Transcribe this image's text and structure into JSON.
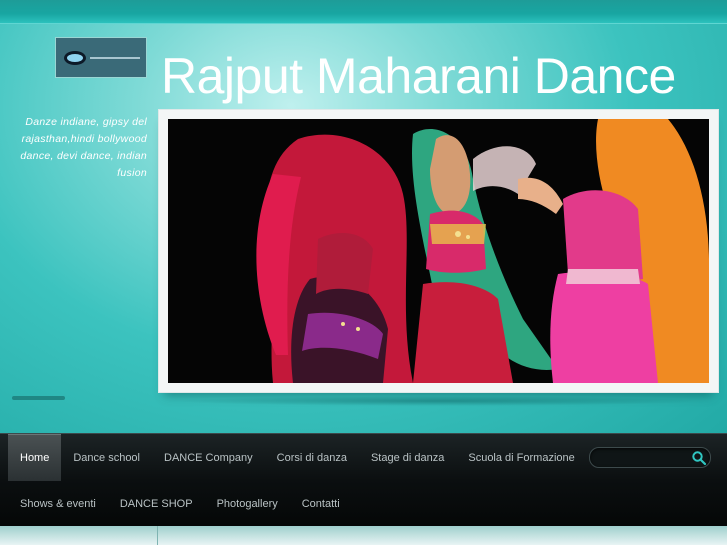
{
  "site": {
    "title": "Rajput Maharani Dance",
    "tagline": "Danze indiane, gipsy del rajasthan,hindi bollywood dance, devi dance, indian fusion"
  },
  "logo": {
    "icon": "eye-logo-icon"
  },
  "hero": {
    "image": "dancers-photo"
  },
  "nav": {
    "row1": [
      {
        "label": "Home",
        "active": true
      },
      {
        "label": "Dance school"
      },
      {
        "label": "DANCE Company"
      },
      {
        "label": "Corsi di danza"
      },
      {
        "label": "Stage di danza"
      },
      {
        "label": "Scuola di Formazione"
      }
    ],
    "row2": [
      {
        "label": "Shows & eventi"
      },
      {
        "label": "DANCE SHOP"
      },
      {
        "label": "Photogallery"
      },
      {
        "label": "Contatti"
      }
    ]
  },
  "search": {
    "value": "",
    "placeholder": "",
    "icon": "search-icon"
  },
  "colors": {
    "header_accent": "#2fb8b4",
    "nav_background": "#0b0f10",
    "search_icon": "#30c7c2"
  }
}
